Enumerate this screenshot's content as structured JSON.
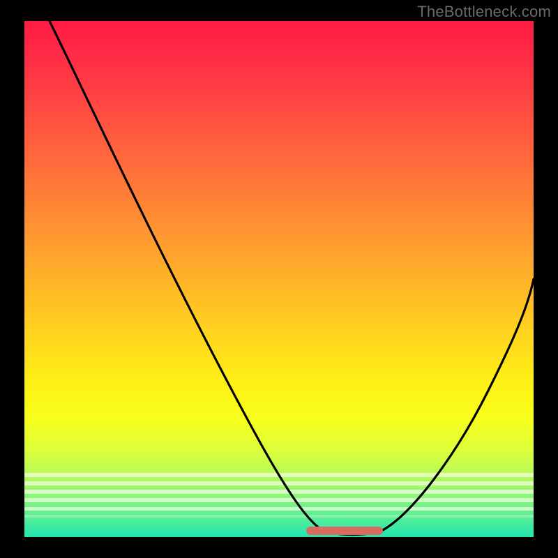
{
  "watermark": "TheBottleneck.com",
  "colors": {
    "frame": "#000000",
    "curve_stroke": "#000000",
    "marker": "#d96b60",
    "watermark_text": "#6a6a6a"
  },
  "chart_data": {
    "type": "line",
    "title": "",
    "xlabel": "",
    "ylabel": "",
    "xlim": [
      0,
      100
    ],
    "ylim": [
      0,
      100
    ],
    "gradient_stops": [
      {
        "pct": 0,
        "color": "#ff1b44"
      },
      {
        "pct": 16,
        "color": "#ff4742"
      },
      {
        "pct": 38,
        "color": "#ff8c34"
      },
      {
        "pct": 60,
        "color": "#ffd21f"
      },
      {
        "pct": 77,
        "color": "#f7ff1b"
      },
      {
        "pct": 92,
        "color": "#8df579"
      },
      {
        "pct": 100,
        "color": "#22e6b0"
      }
    ],
    "series": [
      {
        "name": "bottleneck-curve",
        "x": [
          0,
          5,
          10,
          15,
          20,
          25,
          30,
          35,
          40,
          45,
          50,
          55,
          58,
          62,
          66,
          70,
          75,
          80,
          85,
          90,
          95,
          100
        ],
        "values": [
          100,
          92,
          84,
          76,
          68,
          60,
          52,
          44,
          36,
          28,
          20,
          12,
          6,
          1,
          0,
          1,
          6,
          13,
          21,
          30,
          40,
          50
        ]
      }
    ],
    "optimal_region": {
      "x_start": 58,
      "x_end": 70,
      "y": 0
    },
    "note": "Values estimated from gradient position; axes unlabeled in source."
  }
}
